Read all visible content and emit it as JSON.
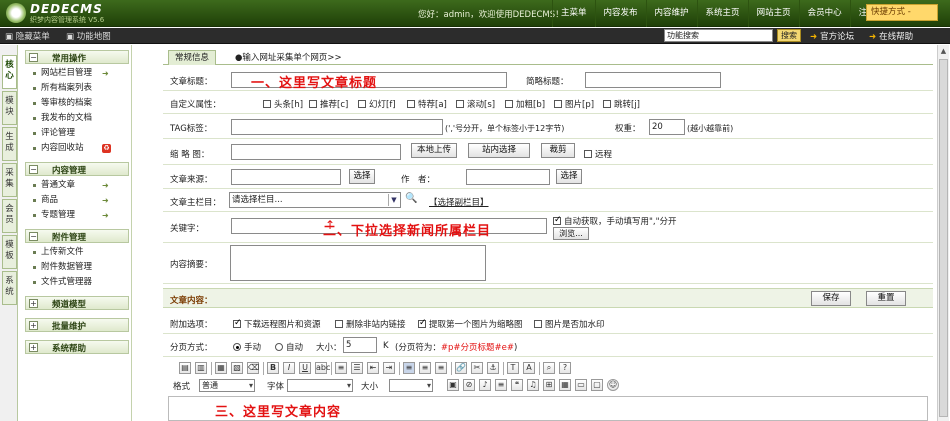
{
  "header": {
    "brand": "DEDECMS",
    "brand_sub": "织梦内容管理系统",
    "version": "V5.6",
    "welcome": "您好：admin，欢迎使用DEDECMS！",
    "nav": [
      "主菜单",
      "内容发布",
      "内容维护",
      "系统主页",
      "网站主页",
      "会员中心",
      "注销"
    ],
    "quick": "快捷方式 -"
  },
  "subbar": {
    "hide_menu": "隐藏菜单",
    "func_map": "功能地图",
    "search_value": "功能搜索",
    "search_btn": "搜索",
    "forum": "官方论坛",
    "help": "在线帮助"
  },
  "left_tabs": [
    "核心",
    "模块",
    "生成",
    "采集",
    "会员",
    "模板",
    "系统"
  ],
  "sidebar": {
    "groups": [
      {
        "title": "常用操作",
        "items": [
          "网站栏目管理",
          "所有档案列表",
          "等审核的档案",
          "我发布的文档",
          "评论管理",
          "内容回收站"
        ]
      },
      {
        "title": "内容管理",
        "items": [
          "普通文章",
          "商品",
          "专题管理"
        ]
      },
      {
        "title": "附件管理",
        "items": [
          "上传新文件",
          "附件数据管理",
          "文件式管理器"
        ]
      },
      {
        "title": "频道模型",
        "items": []
      },
      {
        "title": "批量维护",
        "items": []
      },
      {
        "title": "系统帮助",
        "items": []
      }
    ]
  },
  "form": {
    "tab_general": "常规信息",
    "tab_collect": "●输入网址采集单个网页>>",
    "title_label": "文章标题：",
    "short_title_label": "简略标题：",
    "attr_label": "自定义属性：",
    "attrs": [
      "头条[h]",
      "推荐[c]",
      "幻灯[f]",
      "特荐[a]",
      "滚动[s]",
      "加粗[b]",
      "图片[p]",
      "跳转[j]"
    ],
    "tag_label": "TAG标签：",
    "tag_hint": "(','号分开，单个标签小于12字节)",
    "weight_label": "权重：",
    "weight_value": "20",
    "weight_hint": "(越小越靠前)",
    "thumb_label": "缩 略 图：",
    "upload_btn": "本地上传",
    "site_select_btn": "站内选择",
    "crop_btn": "裁剪",
    "remote_label": "远程",
    "source_label": "文章来源：",
    "select_btn": "选择",
    "author_label": "作　者：",
    "category_label": "文章主栏目：",
    "category_value": "请选择栏目...",
    "sub_category": "【选择副栏目】",
    "keywords_label": "关键字：",
    "auto_fetch": "自动获取，手动填写用\",\"分开",
    "browse_btn": "浏览...",
    "summary_label": "内容摘要：",
    "content_section": "文章内容：",
    "save_btn": "保存",
    "reset_btn": "重置",
    "extra_label": "附加选项：",
    "extra_opts": [
      "下载远程图片和资源",
      "删除非站内链接",
      "提取第一个图片为缩略图",
      "图片是否加水印"
    ],
    "paging_label": "分页方式：",
    "paging_manual": "手动",
    "paging_auto": "自动",
    "size_label": "大小：",
    "size_value": "5",
    "size_unit": "K",
    "paging_hint": "(分页符为：",
    "paging_mark": "#p#分页标题#e#",
    "paging_hint_end": ")",
    "format_label": "格式",
    "format_value": "普通",
    "font_label": "字体",
    "fontsize_label": "大小"
  },
  "annotations": {
    "a1": "一、这里写文章标题",
    "a2": "二、下拉选择新闻所属栏目",
    "a3": "三、这里写文章内容"
  }
}
